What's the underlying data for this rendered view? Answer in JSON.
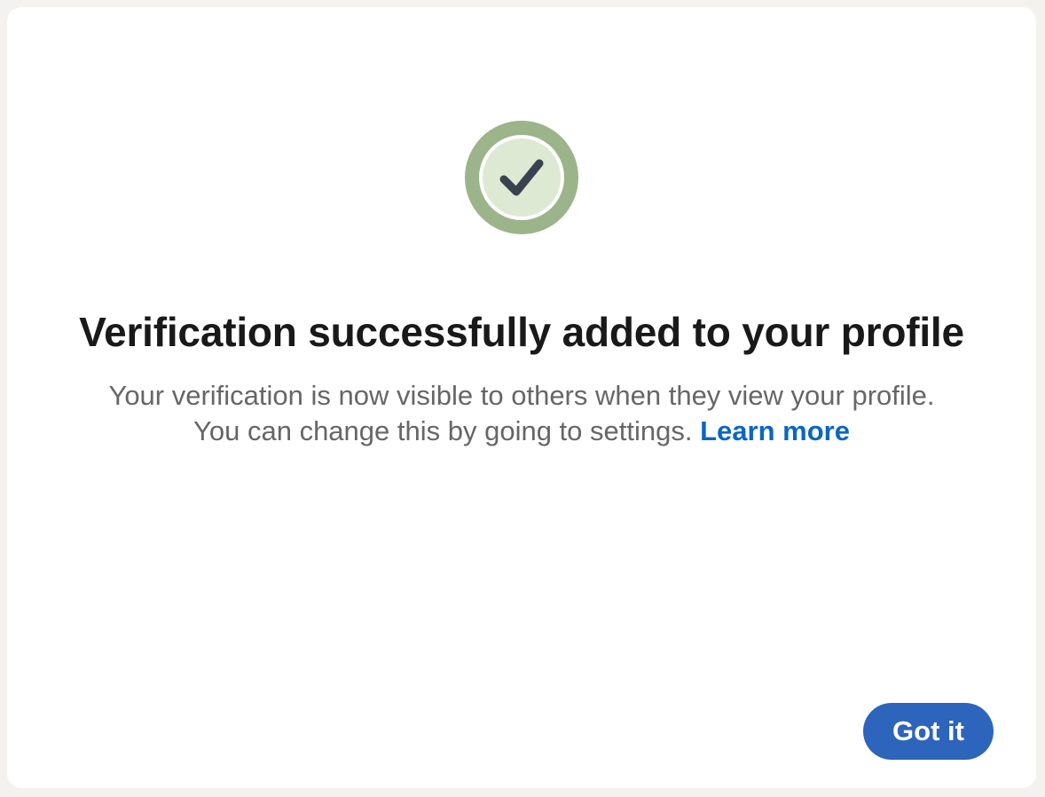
{
  "colors": {
    "page_background": "#f3f2ef",
    "modal_background": "#ffffff",
    "badge_outer_ring": "#9bb48a",
    "badge_inner_ring": "#ffffff",
    "badge_fill": "#dde9d3",
    "checkmark": "#38434f",
    "title_text": "#191919",
    "body_text": "#666666",
    "link": "#0a66c2",
    "primary_button": "#2d64bc"
  },
  "dialog": {
    "icon": "checkmark-circle-icon",
    "title": "Verification successfully added to your profile",
    "description_line1": "Your verification is now visible to others when they view your profile.",
    "description_line2": "You can change this by going to settings.",
    "learn_more_label": "Learn more",
    "primary_button_label": "Got it"
  }
}
